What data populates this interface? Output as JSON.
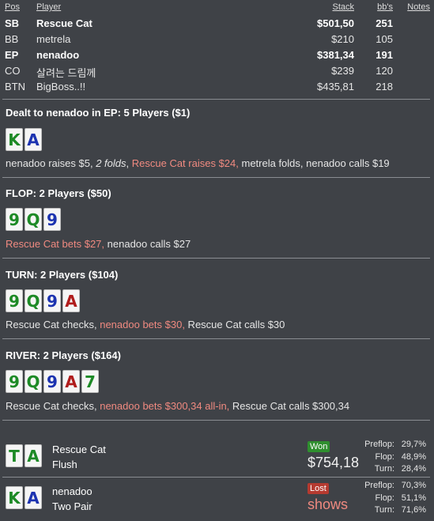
{
  "header": {
    "pos": "Pos",
    "player": "Player",
    "stack": "Stack",
    "bb": "bb's",
    "notes": "Notes"
  },
  "players": [
    {
      "pos": "SB",
      "name": "Rescue Cat",
      "stack": "$501,50",
      "bb": "251",
      "bold": true
    },
    {
      "pos": "BB",
      "name": "metrela",
      "stack": "$210",
      "bb": "105",
      "bold": false
    },
    {
      "pos": "EP",
      "name": "nenadoo",
      "stack": "$381,34",
      "bb": "191",
      "bold": true
    },
    {
      "pos": "CO",
      "name": "살려는 드림께",
      "stack": "$239",
      "bb": "120",
      "bold": false
    },
    {
      "pos": "BTN",
      "name": "BigBoss..!!",
      "stack": "$435,81",
      "bb": "218",
      "bold": false
    }
  ],
  "streets": [
    {
      "title": "Dealt to nenadoo in EP: 5 Players ($1)",
      "cards": [
        {
          "rank": "K",
          "suit": "green"
        },
        {
          "rank": "A",
          "suit": "blue"
        }
      ],
      "actions": [
        {
          "text": "nenadoo raises $5, ",
          "style": ""
        },
        {
          "text": "2 folds",
          "style": "it"
        },
        {
          "text": ", ",
          "style": ""
        },
        {
          "text": "Rescue Cat raises $24,",
          "style": "hl"
        },
        {
          "text": " metrela folds, nenadoo calls $19",
          "style": ""
        }
      ]
    },
    {
      "title": "FLOP: 2 Players ($50)",
      "cards": [
        {
          "rank": "9",
          "suit": "green"
        },
        {
          "rank": "Q",
          "suit": "green"
        },
        {
          "rank": "9",
          "suit": "blue"
        }
      ],
      "actions": [
        {
          "text": "Rescue Cat bets $27,",
          "style": "hl"
        },
        {
          "text": " nenadoo calls $27",
          "style": ""
        }
      ]
    },
    {
      "title": "TURN: 2 Players ($104)",
      "cards": [
        {
          "rank": "9",
          "suit": "green"
        },
        {
          "rank": "Q",
          "suit": "green"
        },
        {
          "rank": "9",
          "suit": "blue"
        },
        {
          "rank": "A",
          "suit": "red"
        }
      ],
      "actions": [
        {
          "text": "Rescue Cat checks, ",
          "style": ""
        },
        {
          "text": "nenadoo bets $30,",
          "style": "hl"
        },
        {
          "text": " Rescue Cat calls $30",
          "style": ""
        }
      ]
    },
    {
      "title": "RIVER: 2 Players ($164)",
      "cards": [
        {
          "rank": "9",
          "suit": "green"
        },
        {
          "rank": "Q",
          "suit": "green"
        },
        {
          "rank": "9",
          "suit": "blue"
        },
        {
          "rank": "A",
          "suit": "red"
        },
        {
          "rank": "7",
          "suit": "green"
        }
      ],
      "actions": [
        {
          "text": "Rescue Cat checks, ",
          "style": ""
        },
        {
          "text": "nenadoo bets $300,34 all-in,",
          "style": "hl"
        },
        {
          "text": " Rescue Cat calls $300,34",
          "style": ""
        }
      ]
    }
  ],
  "results": [
    {
      "cards": [
        {
          "rank": "T",
          "suit": "green"
        },
        {
          "rank": "A",
          "suit": "green"
        }
      ],
      "name": "Rescue Cat",
      "hand": "Flush",
      "badge": "Won",
      "badge_type": "won",
      "amount": "$754,18",
      "amount_color": "#f0f0f0",
      "equity": [
        {
          "label": "Preflop:",
          "value": "29,7%"
        },
        {
          "label": "Flop:",
          "value": "48,9%"
        },
        {
          "label": "Turn:",
          "value": "28,4%"
        }
      ]
    },
    {
      "cards": [
        {
          "rank": "K",
          "suit": "green"
        },
        {
          "rank": "A",
          "suit": "blue"
        }
      ],
      "name": "nenadoo",
      "hand": "Two Pair",
      "badge": "Lost",
      "badge_type": "lost",
      "amount": "shows",
      "amount_color": "#f08a80",
      "equity": [
        {
          "label": "Preflop:",
          "value": "70,3%"
        },
        {
          "label": "Flop:",
          "value": "51,1%"
        },
        {
          "label": "Turn:",
          "value": "71,6%"
        }
      ]
    }
  ],
  "suit_colors": {
    "green": "#1d8a26",
    "blue": "#1c33b0",
    "red": "#b01c1c"
  }
}
